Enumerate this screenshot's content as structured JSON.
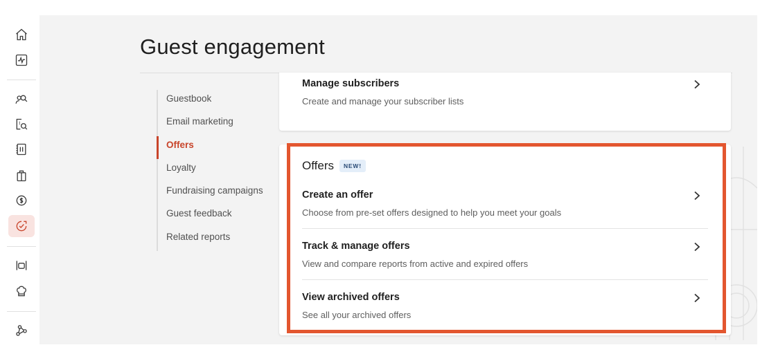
{
  "page": {
    "title": "Guest engagement"
  },
  "rail": {
    "icons": [
      "home-icon",
      "activity-icon",
      "guests-icon",
      "payments-search-icon",
      "menu-icon",
      "gift-card-icon",
      "cash-icon",
      "engagement-icon",
      "dining-icon",
      "chef-icon",
      "integrations-icon"
    ],
    "active": "engagement-icon"
  },
  "subnav": {
    "items": [
      {
        "label": "Guestbook",
        "active": false
      },
      {
        "label": "Email marketing",
        "active": false
      },
      {
        "label": "Offers",
        "active": true
      },
      {
        "label": "Loyalty",
        "active": false
      },
      {
        "label": "Fundraising campaigns",
        "active": false
      },
      {
        "label": "Guest feedback",
        "active": false
      },
      {
        "label": "Related reports",
        "active": false
      }
    ]
  },
  "subscribers_card": {
    "title": "Manage subscribers",
    "description": "Create and manage your subscriber lists"
  },
  "offers_card": {
    "heading": "Offers",
    "badge": "NEW!",
    "rows": [
      {
        "title": "Create an offer",
        "description": "Choose from pre-set offers designed to help you meet your goals"
      },
      {
        "title": "Track & manage offers",
        "description": "View and compare reports from active and expired offers"
      },
      {
        "title": "View archived offers",
        "description": "See all your archived offers"
      }
    ]
  },
  "colors": {
    "accent": "#c8442a",
    "highlight": "#e3562f",
    "badge_bg": "#e4eef9"
  }
}
